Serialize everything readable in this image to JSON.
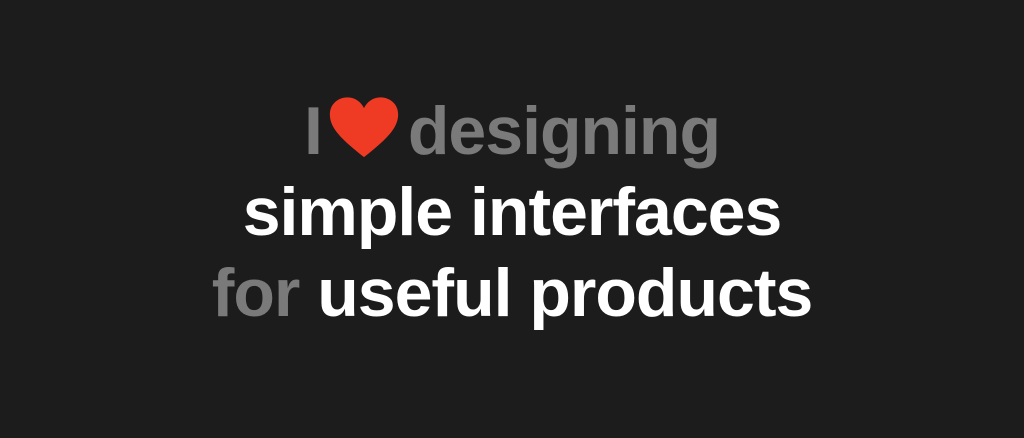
{
  "hero": {
    "line1": {
      "prefix": "I",
      "heart_icon": "heart-icon",
      "suffix": "designing"
    },
    "line2": {
      "text": "simple interfaces"
    },
    "line3": {
      "muted": "for",
      "bright": "useful products"
    }
  },
  "colors": {
    "background": "#1c1c1c",
    "muted_text": "#7a7a7a",
    "bright_text": "#ffffff",
    "heart": "#ef3b24"
  }
}
